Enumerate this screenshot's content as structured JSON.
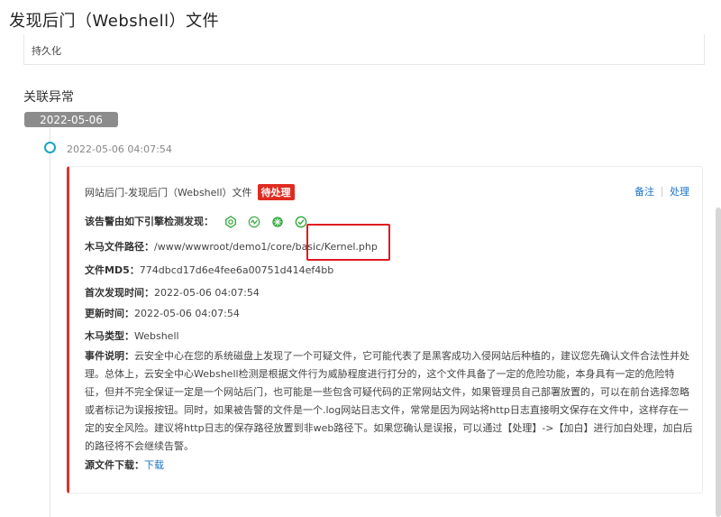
{
  "page": {
    "title": "发现后门（Webshell）文件",
    "persistence": "持久化"
  },
  "related": {
    "title": "关联异常",
    "date": "2022-05-06"
  },
  "event": {
    "time": "2022-05-06 04:07:54",
    "alert_name": "网站后门-发现后门（Webshell）文件",
    "status": "待处理",
    "actions": {
      "note": "备注",
      "handle": "处理"
    },
    "engines_label": "该告警由如下引擎检测发现：",
    "engines": [
      "engine-icon-1",
      "engine-icon-2",
      "engine-icon-3",
      "engine-icon-4"
    ],
    "path_label": "木马文件路径：",
    "path": "/www/wwwroot/demo1/core/basic/Kernel.php",
    "md5_label": "文件MD5：",
    "md5": "774dbcd17d6e4fee6a00751d414ef4bb",
    "first_seen_label": "首次发现时间：",
    "first_seen": "2022-05-06 04:07:54",
    "updated_label": "更新时间：",
    "updated": "2022-05-06 04:07:54",
    "type_label": "木马类型：",
    "type": "Webshell",
    "desc_label": "事件说明：",
    "desc": "云安全中心在您的系统磁盘上发现了一个可疑文件，它可能代表了是黑客成功入侵网站后种植的，建议您先确认文件合法性并处理。总体上，云安全中心Webshell检测是根据文件行为威胁程度进行打分的，这个文件具备了一定的危险功能，本身具有一定的危险特征，但并不完全保证一定是一个网站后门，也可能是一些包含可疑代码的正常网站文件，如果管理员自己部署放置的，可以在前台选择忽略或者标记为误报按钮。同时，如果被告警的文件是一个.log网站日志文件，常常是因为网站将http日志直接明文保存在文件中，这样存在一定的安全风险。建议将http日志的保存路径放置到非web路径下。如果您确认是误报，可以通过【处理】->【加白】进行加白处理，加白后的路径将不会继续告警。",
    "download_label": "源文件下载：",
    "download": "下载"
  },
  "colors": {
    "accent": "#1a73c8",
    "alert_red": "#e02b20",
    "timeline_dot": "#1aa6c4",
    "engine_green": "#2fa83a"
  }
}
